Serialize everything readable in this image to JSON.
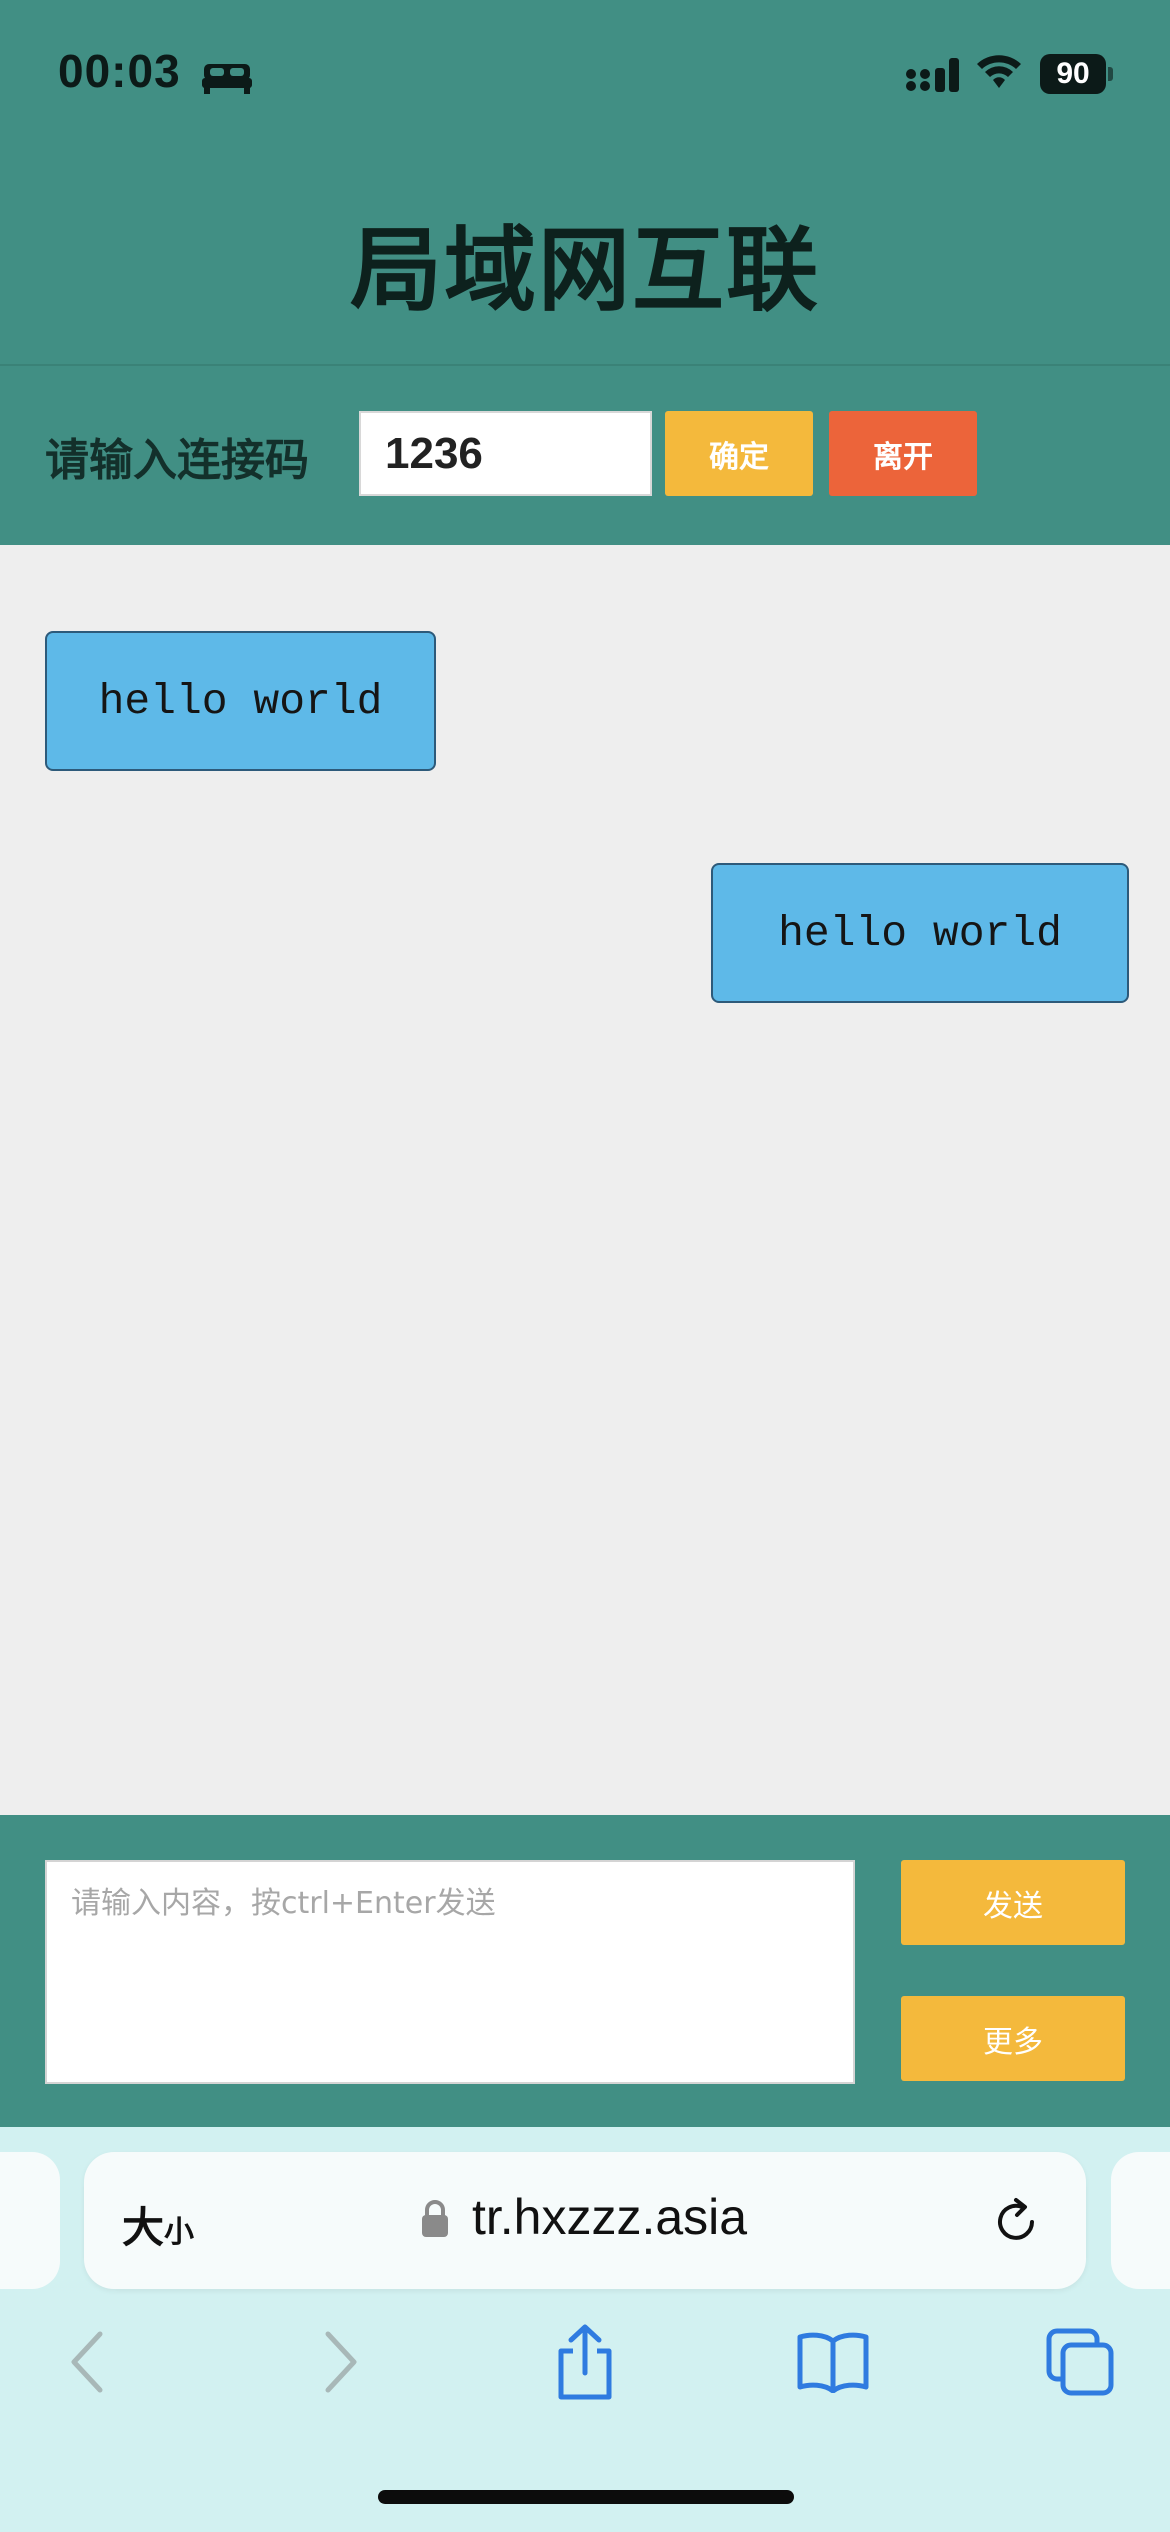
{
  "status_bar": {
    "time": "00:03",
    "battery": "90",
    "icons": [
      "bed-icon",
      "signal-icon",
      "wifi-icon",
      "battery-icon"
    ]
  },
  "header": {
    "title": "局域网互联",
    "connection": {
      "label": "请输入连接码",
      "code_value": "1236",
      "confirm_label": "确定",
      "leave_label": "离开"
    }
  },
  "messages": [
    {
      "text": "hello world",
      "side": "left"
    },
    {
      "text": "hello world",
      "side": "right"
    }
  ],
  "composer": {
    "placeholder": "请输入内容，按ctrl+Enter发送",
    "value": "",
    "send_label": "发送",
    "more_label": "更多"
  },
  "browser": {
    "text_size_big": "大",
    "text_size_small": "小",
    "url": "tr.hxzzz.asia",
    "toolbar_icons": [
      "back-icon",
      "forward-icon",
      "share-icon",
      "bookmarks-icon",
      "tabs-icon"
    ]
  },
  "colors": {
    "header_bg": "#418f84",
    "confirm_bg": "#f4b93c",
    "leave_bg": "#ec643a",
    "bubble_bg": "#5eb9e8",
    "chat_bg": "#eeeeee",
    "browser_bg": "#d2f1f1",
    "toolbar_icon": "#2f7be0"
  }
}
